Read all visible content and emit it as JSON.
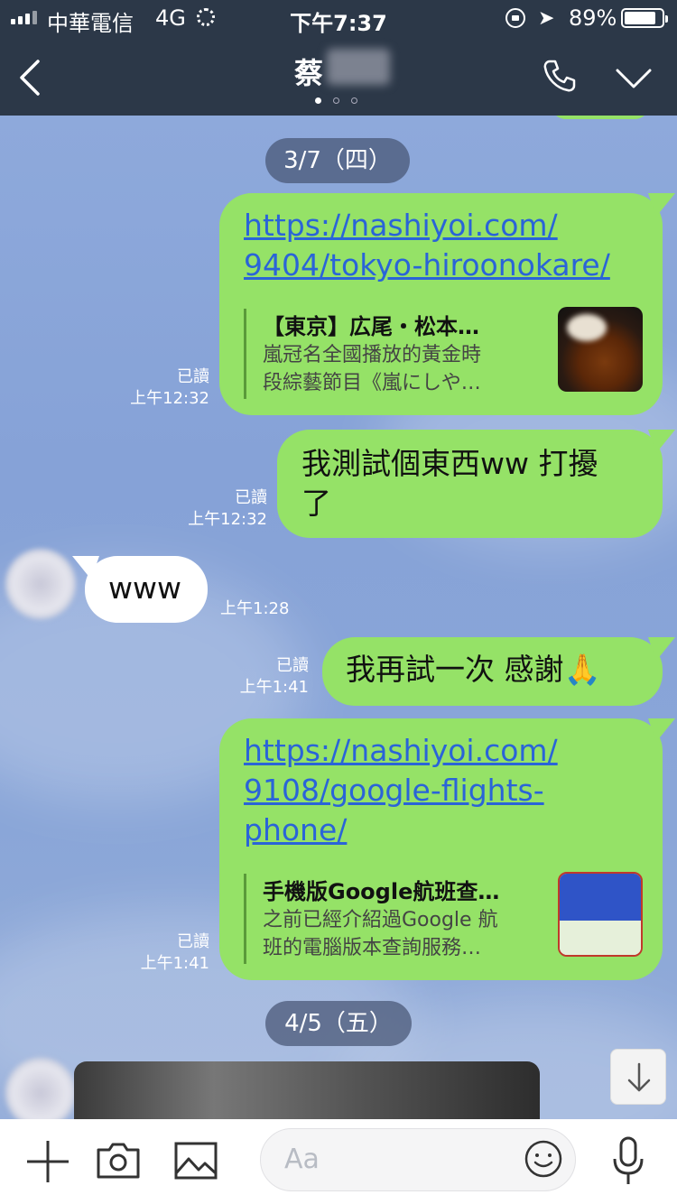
{
  "status_bar": {
    "carrier": "中華電信",
    "network": "4G",
    "time": "下午7:37",
    "battery": "89%"
  },
  "header": {
    "contact_name": "蔡"
  },
  "messages": {
    "date1": "3/7（四）",
    "m1": {
      "link_line1": "https://nashiyoi.com/",
      "link_line2": "9404/tokyo-hiroonokare/",
      "preview_title": "【東京】広尾・松本…",
      "preview_desc_line1": "嵐冠名全國播放的黃金時",
      "preview_desc_line2": "段綜藝節目《嵐にしや…",
      "read": "已讀",
      "time": "上午12:32"
    },
    "m2": {
      "line1": "我測試個東西ww 打擾",
      "line2": "了",
      "read": "已讀",
      "time": "上午12:32"
    },
    "m3": {
      "text": "www",
      "time": "上午1:28"
    },
    "m4": {
      "text": "我再試一次 感謝🙏",
      "read": "已讀",
      "time": "上午1:41"
    },
    "m5": {
      "link_line1": "https://nashiyoi.com/",
      "link_line2": "9108/google-flights-",
      "link_line3": "phone/",
      "preview_title": "手機版Google航班查…",
      "preview_desc_line1": "之前已經介紹過Google 航",
      "preview_desc_line2": "班的電腦版本查詢服務…",
      "read": "已讀",
      "time": "上午1:41"
    },
    "date2": "4/5（五）"
  },
  "input": {
    "placeholder": "Aa"
  },
  "colors": {
    "header_bg": "#2c3848",
    "chat_bg": "#8ea9db",
    "bubble_green": "#95e267",
    "link": "#2a64d8"
  }
}
